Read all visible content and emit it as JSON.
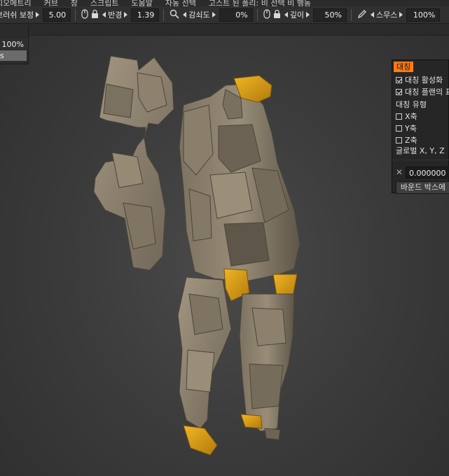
{
  "menu": {
    "items": [
      "지오메트리",
      "커브",
      "창",
      "스크립트",
      "도움말",
      "자동 선택",
      "고스트 된 폴리: 비 선택 비 행동"
    ]
  },
  "toolbar": {
    "correction_label": "브러쉬 보정",
    "correction_value": "5.00",
    "radius_label": "반경",
    "radius_value": "1.39",
    "falloff_label": "감쇠도",
    "falloff_value": "0%",
    "depth_label": "깊이",
    "depth_value": "50%",
    "space_label": "스무스",
    "space_value": "100%"
  },
  "left_panel": {
    "value": "100%",
    "selected_label": "s"
  },
  "symmetry": {
    "title": "대칭",
    "enable_label": "대칭 활성화",
    "plane_label": "대칭 플랜의 표",
    "type_label": "대칭 유형",
    "x_label": "X축",
    "y_label": "Y축",
    "z_label": "Z축",
    "global_label": "글로벌 X, Y, Z",
    "offset_value": "0.000000",
    "bbox_button": "바운드 박스에"
  },
  "colors": {
    "accent": "#ff7a12",
    "model_body": "#8a7d6a",
    "model_gold": "#d79a14"
  }
}
